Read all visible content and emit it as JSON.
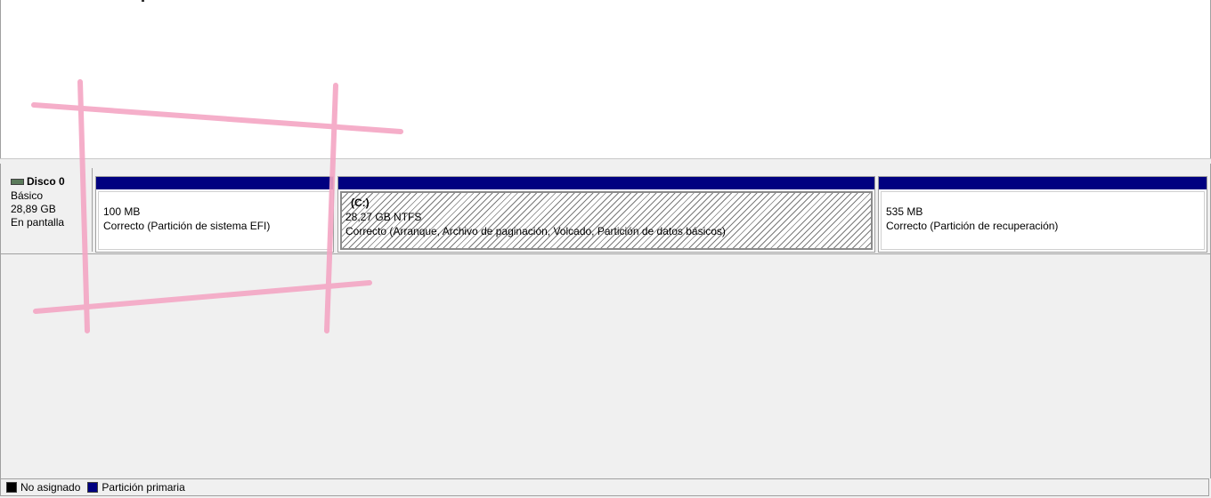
{
  "disk": {
    "name": "Disco 0",
    "type": "Básico",
    "size": "28,89 GB",
    "status": "En pantalla"
  },
  "partitions": [
    {
      "letter": "",
      "size": "100 MB",
      "status": "Correcto (Partición de sistema EFI)"
    },
    {
      "letter": "(C:)",
      "size": "28,27 GB NTFS",
      "status": "Correcto (Arranque, Archivo de paginación, Volcado, Partición de datos básicos)"
    },
    {
      "letter": "",
      "size": "535 MB",
      "status": "Correcto (Partición de recuperación)"
    }
  ],
  "legend": {
    "unallocated": "No asignado",
    "primary": "Partición primaria"
  },
  "colors": {
    "primary_partition": "#000080",
    "unallocated": "#000000",
    "annotation": "#f4a6c4"
  },
  "icons": {
    "disk": "disk-drive-icon"
  }
}
